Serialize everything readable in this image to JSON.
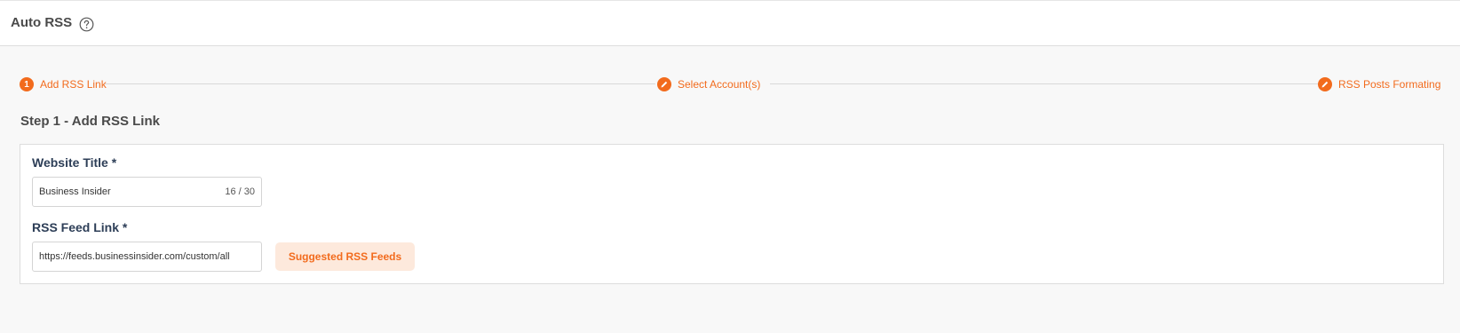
{
  "header": {
    "title": "Auto RSS",
    "help_icon": "question-circle-icon"
  },
  "stepper": {
    "accent_color": "#f26b1d",
    "steps": [
      {
        "indicator": "1",
        "label": "Add RSS Link",
        "icon": "number-badge"
      },
      {
        "indicator": "",
        "label": "Select Account(s)",
        "icon": "pencil-icon"
      },
      {
        "indicator": "",
        "label": "RSS Posts Formating",
        "icon": "pencil-icon"
      }
    ]
  },
  "step_heading": "Step 1 - Add RSS Link",
  "form": {
    "website_title": {
      "label": "Website Title *",
      "value": "Business Insider",
      "counter": "16 / 30"
    },
    "rss_feed_link": {
      "label": "RSS Feed Link *",
      "value": "https://feeds.businessinsider.com/custom/all"
    },
    "suggested_button_label": "Suggested RSS Feeds"
  }
}
